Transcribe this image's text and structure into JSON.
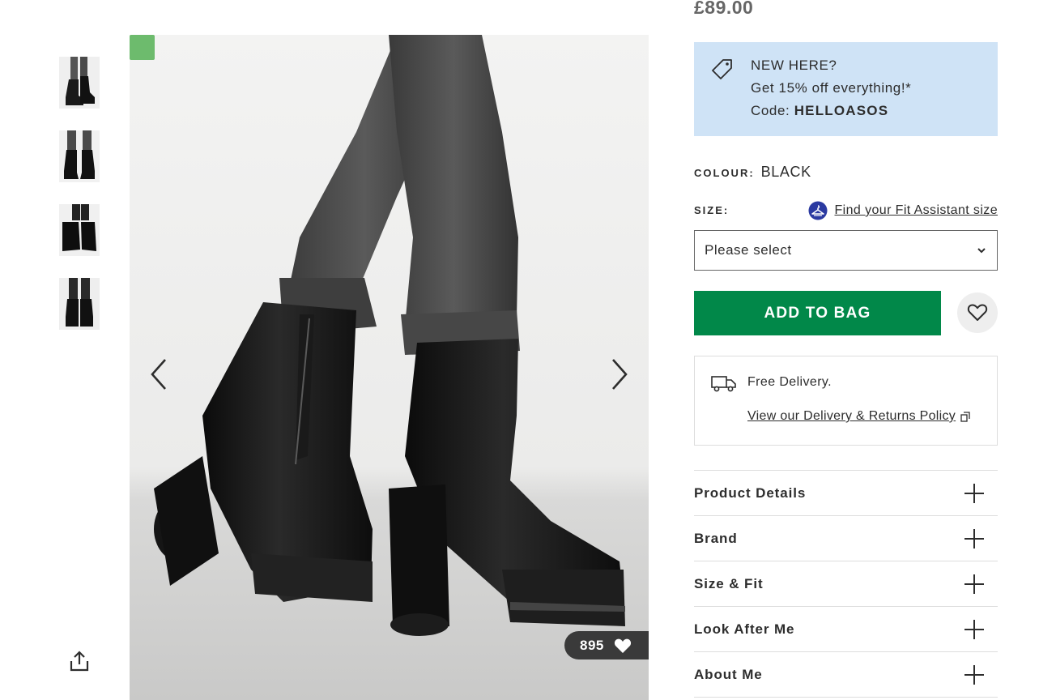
{
  "product": {
    "price": "£89.00",
    "likes_count": "895"
  },
  "promo": {
    "line1": "NEW HERE?",
    "line2": "Get 15% off everything!*",
    "code_label": "Code: ",
    "code": "HELLOASOS"
  },
  "colour": {
    "label": "COLOUR:",
    "value": "BLACK"
  },
  "size": {
    "label": "SIZE:",
    "fit_assistant_link": "Find your Fit Assistant size",
    "placeholder": "Please select"
  },
  "actions": {
    "add_to_bag": "ADD TO BAG"
  },
  "delivery": {
    "free_text": "Free Delivery.",
    "policy_link": "View our Delivery & Returns Policy"
  },
  "accordion": [
    {
      "label": "Product Details"
    },
    {
      "label": "Brand"
    },
    {
      "label": "Size & Fit"
    },
    {
      "label": "Look After Me"
    },
    {
      "label": "About Me"
    }
  ],
  "colors": {
    "add_to_bag_bg": "#018849",
    "promo_bg": "#cfe3f6",
    "badge_green": "#6dbb6d"
  },
  "icons": {
    "thumbnails": [
      "boot-thumbnail-1",
      "boot-thumbnail-2",
      "boot-thumbnail-3",
      "boot-thumbnail-4"
    ],
    "share": "share-icon",
    "prev": "chevron-left-icon",
    "next": "chevron-right-icon",
    "like": "heart-icon",
    "promo": "price-tag-icon",
    "fit": "hanger-icon",
    "select": "chevron-down-icon",
    "save": "heart-outline-icon",
    "delivery": "truck-icon",
    "external": "external-link-icon",
    "accordion": "plus-icon"
  }
}
